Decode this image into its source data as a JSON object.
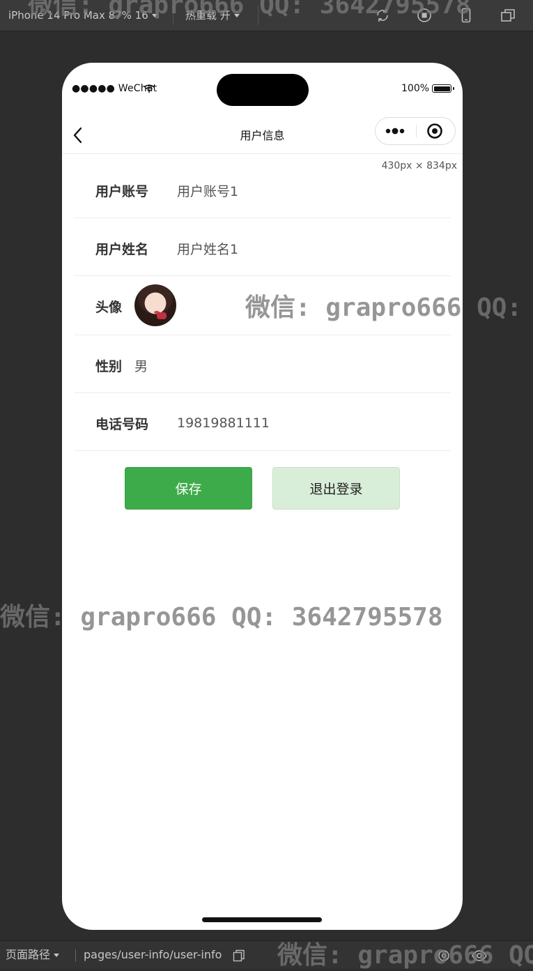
{
  "devtools": {
    "device_label": "iPhone 14 Pro Max 87% 16",
    "hot_reload_label": "热重载 开",
    "path_label": "页面路径",
    "path_value": "pages/user-info/user-info"
  },
  "status_bar": {
    "carrier": "●●●●● WeChat",
    "battery_text": "100%"
  },
  "navbar": {
    "title": "用户信息"
  },
  "size_hint": "430px × 834px",
  "form": {
    "account": {
      "label": "用户账号",
      "value": "用户账号1"
    },
    "name": {
      "label": "用户姓名",
      "value": "用户姓名1"
    },
    "avatar": {
      "label": "头像"
    },
    "gender": {
      "label": "性别",
      "value": "男"
    },
    "phone": {
      "label": "电话号码",
      "value": "19819881111"
    }
  },
  "buttons": {
    "save": "保存",
    "logout": "退出登录"
  },
  "watermark": {
    "text": "微信: grapro666 QQ: 3642795578",
    "text_mid": "微信: grapro666 QQ:",
    "text_bottom": "微信: grapro666 QQ"
  },
  "colors": {
    "save_button": "#3eab4a",
    "logout_button": "#d9eed9",
    "devtools_bg": "#2d2d2d"
  }
}
